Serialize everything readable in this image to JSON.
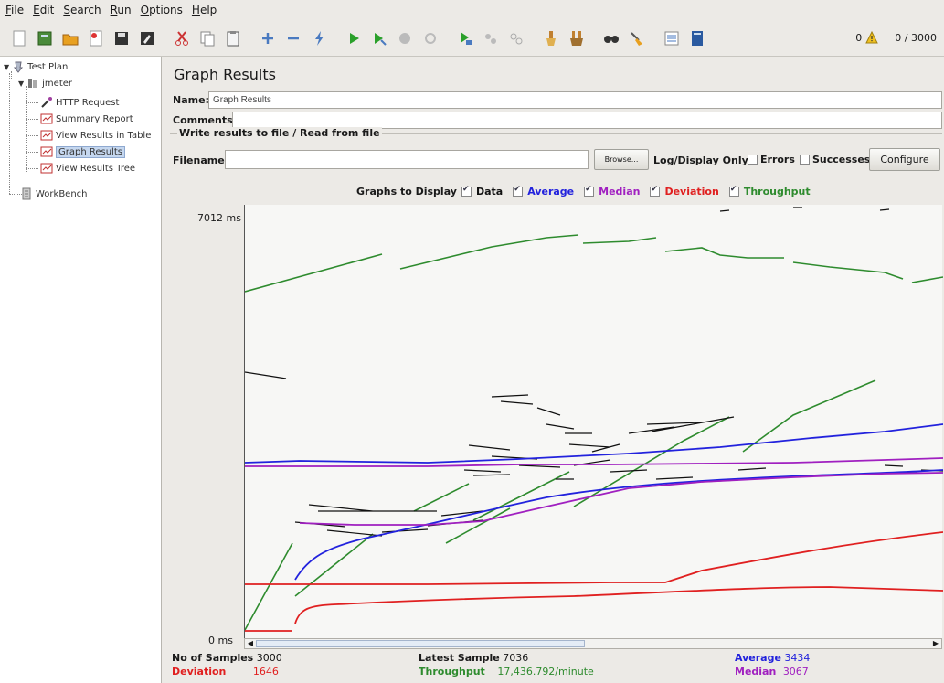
{
  "menu": [
    "File",
    "Edit",
    "Search",
    "Run",
    "Options",
    "Help"
  ],
  "toolbar": {
    "icons": [
      "new-icon",
      "templates-icon",
      "open-icon",
      "open-recent-icon",
      "save-icon",
      "save-as-icon",
      "cut-icon",
      "copy-icon",
      "paste-icon",
      "expand-all-icon",
      "collapse-all-icon",
      "toggle-icon",
      "start-icon",
      "start-no-pauses-icon",
      "stop-icon",
      "shutdown-icon",
      "remote-start-icon",
      "remote-stop-icon",
      "remote-shutdown-icon",
      "clear-icon",
      "clear-all-icon",
      "search-icon",
      "reset-search-icon",
      "function-helper-icon",
      "help-icon"
    ],
    "warning_count": "0",
    "thread_status": "0 / 3000"
  },
  "tree": {
    "test_plan": "Test Plan",
    "jmeter": "jmeter",
    "http_request": "HTTP Request",
    "summary_report": "Summary Report",
    "view_results_table": "View Results in Table",
    "graph_results": "Graph Results",
    "view_results_tree": "View Results Tree",
    "workbench": "WorkBench"
  },
  "panel": {
    "title": "Graph Results",
    "name_label": "Name:",
    "name_value": "Graph Results",
    "comments_label": "Comments:",
    "comments_value": "",
    "file_group_legend": "Write results to file / Read from file",
    "filename_label": "Filename",
    "filename_value": "",
    "browse_label": "Browse...",
    "log_display_label": "Log/Display Only:",
    "errors_label": "Errors",
    "successes_label": "Successes",
    "configure_label": "Configure",
    "graphs_to_display_label": "Graphs to Display",
    "graph_toggles": {
      "data": "Data",
      "average": "Average",
      "median": "Median",
      "deviation": "Deviation",
      "throughput": "Throughput"
    }
  },
  "graph": {
    "y_max_label": "7012 ms",
    "y_min_label": "0 ms",
    "colors": {
      "data": "#111111",
      "average": "#2222dd",
      "median": "#a020c0",
      "deviation": "#e02020",
      "throughput": "#2e8b2e"
    }
  },
  "stats": {
    "samples_label": "No of Samples",
    "samples_value": "3000",
    "latest_label": "Latest Sample",
    "latest_value": "7036",
    "average_label": "Average",
    "average_value": "3434",
    "deviation_label": "Deviation",
    "deviation_value": "1646",
    "throughput_label": "Throughput",
    "throughput_value": "17,436.792/minute",
    "median_label": "Median",
    "median_value": "3067"
  }
}
